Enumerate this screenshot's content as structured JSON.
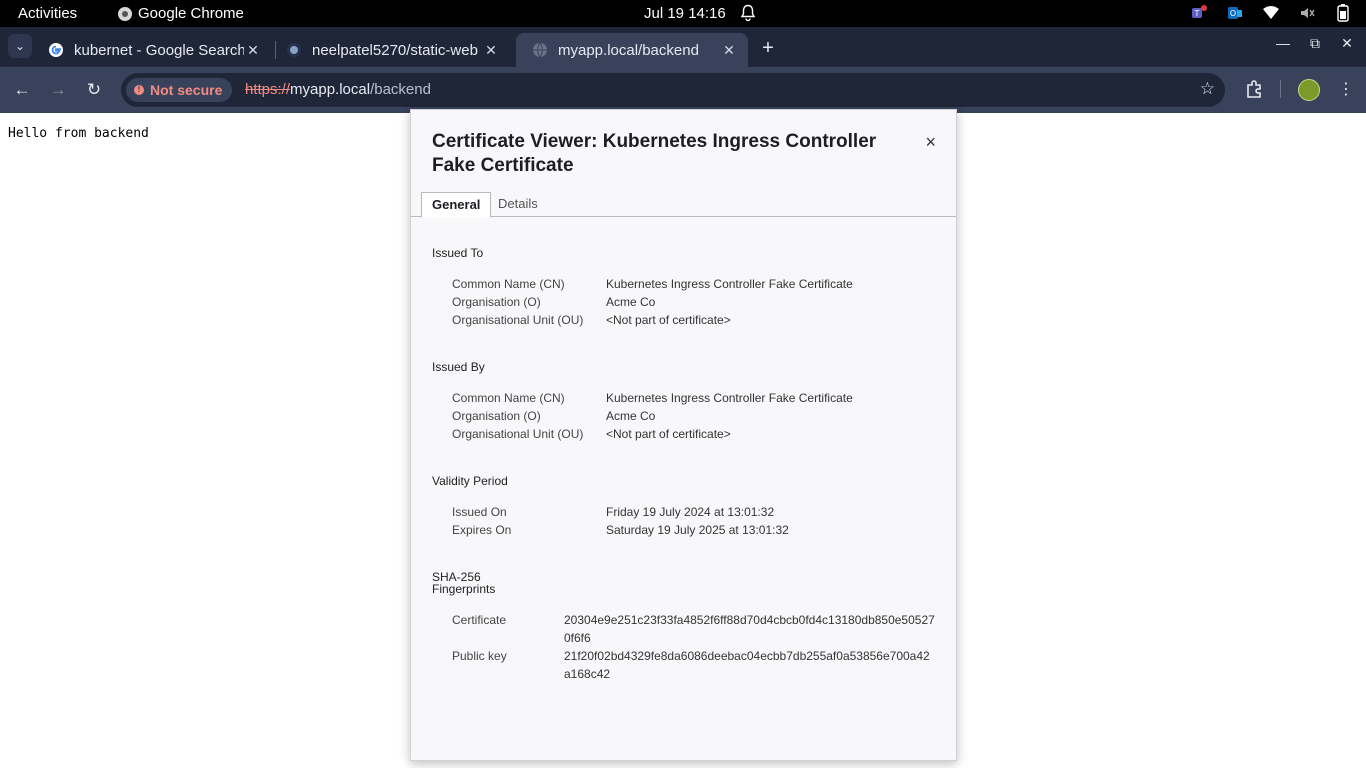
{
  "topbar": {
    "activities": "Activities",
    "app_name": "Google Chrome",
    "clock": "Jul 19  14:16",
    "notification_badge": "1"
  },
  "tabs": [
    {
      "title": "kubernet - Google Search",
      "icon": "google-g-icon"
    },
    {
      "title": "neelpatel5270/static-web",
      "icon": "github-icon"
    },
    {
      "title": "myapp.local/backend",
      "icon": "globe-icon",
      "active": true
    }
  ],
  "toolbar": {
    "security_label": "Not secure",
    "url_scheme": "https://",
    "url_host": "myapp.local",
    "url_path": "/backend"
  },
  "page": {
    "body_text": "Hello from backend"
  },
  "dialog": {
    "title": "Certificate Viewer: Kubernetes Ingress Controller Fake Certificate",
    "close": "×",
    "tab_general": "General",
    "tab_details": "Details",
    "issued_to": {
      "heading": "Issued To",
      "cn_label": "Common Name (CN)",
      "cn_value": "Kubernetes Ingress Controller Fake Certificate",
      "o_label": "Organisation (O)",
      "o_value": "Acme Co",
      "ou_label": "Organisational Unit (OU)",
      "ou_value": "<Not part of certificate>"
    },
    "issued_by": {
      "heading": "Issued By",
      "cn_label": "Common Name (CN)",
      "cn_value": "Kubernetes Ingress Controller Fake Certificate",
      "o_label": "Organisation (O)",
      "o_value": "Acme Co",
      "ou_label": "Organisational Unit (OU)",
      "ou_value": "<Not part of certificate>"
    },
    "validity": {
      "heading": "Validity Period",
      "issued_on_label": "Issued On",
      "issued_on_value": "Friday 19 July 2024 at 13:01:32",
      "expires_on_label": "Expires On",
      "expires_on_value": "Saturday 19 July 2025 at 13:01:32"
    },
    "fingerprints": {
      "heading_line1": "SHA-256",
      "heading_line2": "Fingerprints",
      "certificate_label": "Certificate",
      "certificate_value": "20304e9e251c23f33fa4852f6ff88d70d4cbcb0fd4c13180db850e505270f6f6",
      "public_key_label": "Public key",
      "public_key_value": "21f20f02bd4329fe8da6086deebac04ecbb7db255af0a53856e700a42a168c42"
    }
  }
}
